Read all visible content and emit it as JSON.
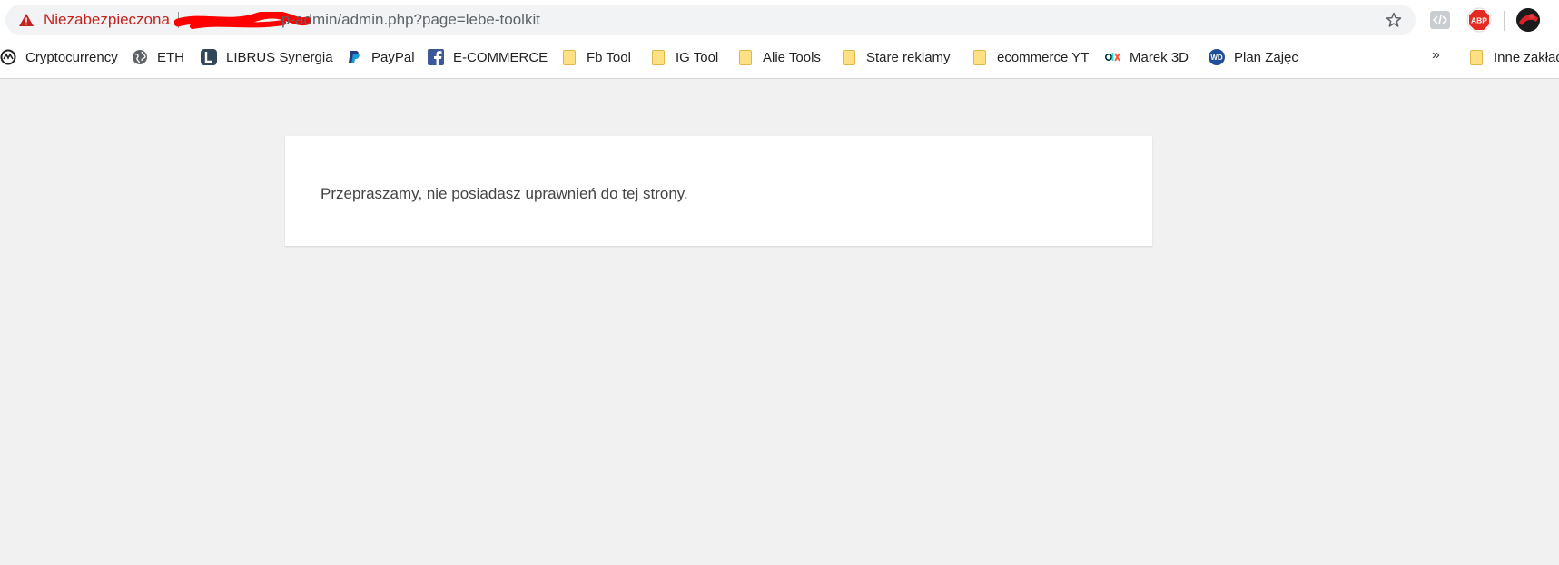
{
  "address_bar": {
    "security_label": "Niezabezpieczona",
    "url_visible": "p-admin/admin.php?page=lebe-toolkit"
  },
  "bookmarks": [
    {
      "label": "Cryptocurrency",
      "icon": "coinmarketcap-icon"
    },
    {
      "label": "ETH",
      "icon": "globe-icon"
    },
    {
      "label": "LIBRUS Synergia",
      "icon": "librus-icon"
    },
    {
      "label": "PayPal",
      "icon": "paypal-icon"
    },
    {
      "label": "E-COMMERCE",
      "icon": "facebook-icon"
    },
    {
      "label": "Fb Tool",
      "icon": "folder-icon"
    },
    {
      "label": "IG Tool",
      "icon": "folder-icon"
    },
    {
      "label": "Alie Tools",
      "icon": "folder-icon"
    },
    {
      "label": "Stare reklamy",
      "icon": "folder-icon"
    },
    {
      "label": "ecommerce YT",
      "icon": "folder-icon"
    },
    {
      "label": "Marek 3D",
      "icon": "olx-icon"
    },
    {
      "label": "Plan Zajęc",
      "icon": "wd-icon"
    },
    {
      "label": "Inne zakład",
      "icon": "folder-icon"
    }
  ],
  "overflow_label": "»",
  "extensions": {
    "abp_label": "ABP"
  },
  "main": {
    "message": "Przepraszamy, nie posiadasz uprawnień do tej strony."
  },
  "colors": {
    "insecure": "#c5221f",
    "page_background": "#f1f1f1",
    "card": "#ffffff"
  }
}
